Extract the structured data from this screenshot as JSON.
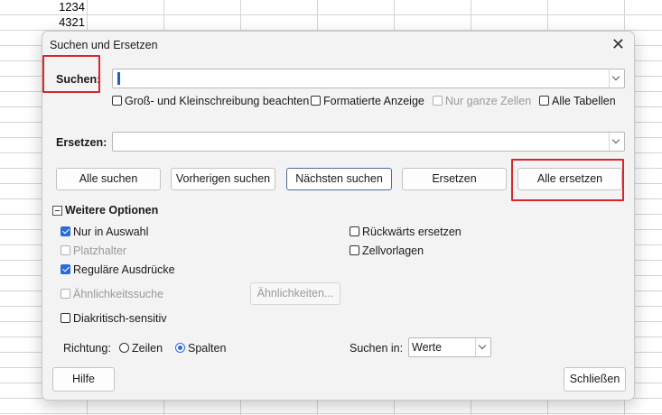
{
  "sheet": {
    "cell_values": [
      "1234",
      "4321"
    ]
  },
  "dialog": {
    "title": "Suchen und Ersetzen",
    "close_glyph": "✕",
    "search": {
      "label": "Suchen:",
      "value": "",
      "options": [
        {
          "label": "Groß- und Kleinschreibung beachten",
          "checked": false,
          "enabled": true
        },
        {
          "label": "Formatierte Anzeige",
          "checked": false,
          "enabled": true
        },
        {
          "label": "Nur ganze Zellen",
          "checked": false,
          "enabled": false
        },
        {
          "label": "Alle Tabellen",
          "checked": false,
          "enabled": true
        }
      ]
    },
    "replace": {
      "label": "Ersetzen:",
      "value": ""
    },
    "buttons": {
      "find_all": "Alle suchen",
      "find_prev": "Vorherigen suchen",
      "find_next": "Nächsten suchen",
      "replace": "Ersetzen",
      "replace_all": "Alle ersetzen"
    },
    "more_options": {
      "label": "Weitere Optionen",
      "left": [
        {
          "label": "Nur in Auswahl",
          "checked": true,
          "enabled": true
        },
        {
          "label": "Platzhalter",
          "checked": false,
          "enabled": false
        },
        {
          "label": "Reguläre Ausdrücke",
          "checked": true,
          "enabled": true
        },
        {
          "label": "Ähnlichkeitssuche",
          "checked": false,
          "enabled": false
        },
        {
          "label": "Diakritisch-sensitiv",
          "checked": false,
          "enabled": true
        }
      ],
      "right": [
        {
          "label": "Rückwärts ersetzen",
          "checked": false,
          "enabled": true
        },
        {
          "label": "Zellvorlagen",
          "checked": false,
          "enabled": true
        }
      ],
      "similarity_button": "Ähnlichkeiten...",
      "direction": {
        "label": "Richtung:",
        "options": [
          {
            "label": "Zeilen",
            "selected": false
          },
          {
            "label": "Spalten",
            "selected": true
          }
        ]
      },
      "search_in": {
        "label": "Suchen in:",
        "value": "Werte"
      }
    },
    "footer": {
      "help": "Hilfe",
      "close": "Schließen"
    }
  },
  "colors": {
    "highlight": "#d7262c",
    "accent": "#2a6bd8"
  }
}
